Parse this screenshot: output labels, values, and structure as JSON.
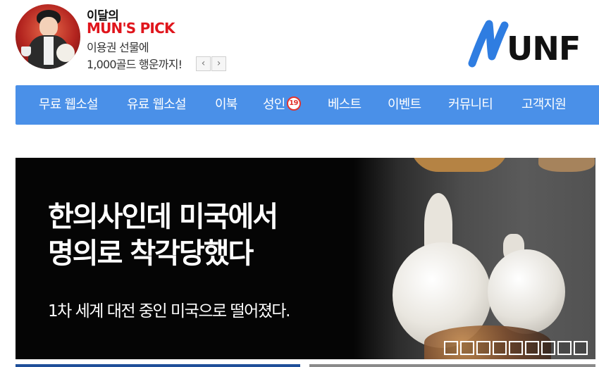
{
  "promo": {
    "title": "이달의",
    "brand": "MUN'S PICK",
    "line1": "이용권 선물에",
    "line2": "1,000골드 행운까지!",
    "prev_label": "‹",
    "next_label": "›"
  },
  "logo": {
    "text": "UNF",
    "accent_color": "#2f7de1"
  },
  "nav": {
    "color": "#4a90e8",
    "items": [
      {
        "label": "무료 웹소설"
      },
      {
        "label": "유료 웹소설"
      },
      {
        "label": "이북"
      },
      {
        "label": "성인",
        "badge": "19"
      },
      {
        "label": "베스트"
      },
      {
        "label": "이벤트"
      },
      {
        "label": "커뮤니티"
      },
      {
        "label": "고객지원"
      }
    ]
  },
  "banner": {
    "headline_line1": "한의사인데 미국에서",
    "headline_line2": "명의로 착각당했다",
    "subtitle": "1차 세계 대전 중인 미국으로 떨어졌다.",
    "slide_count": 9
  }
}
